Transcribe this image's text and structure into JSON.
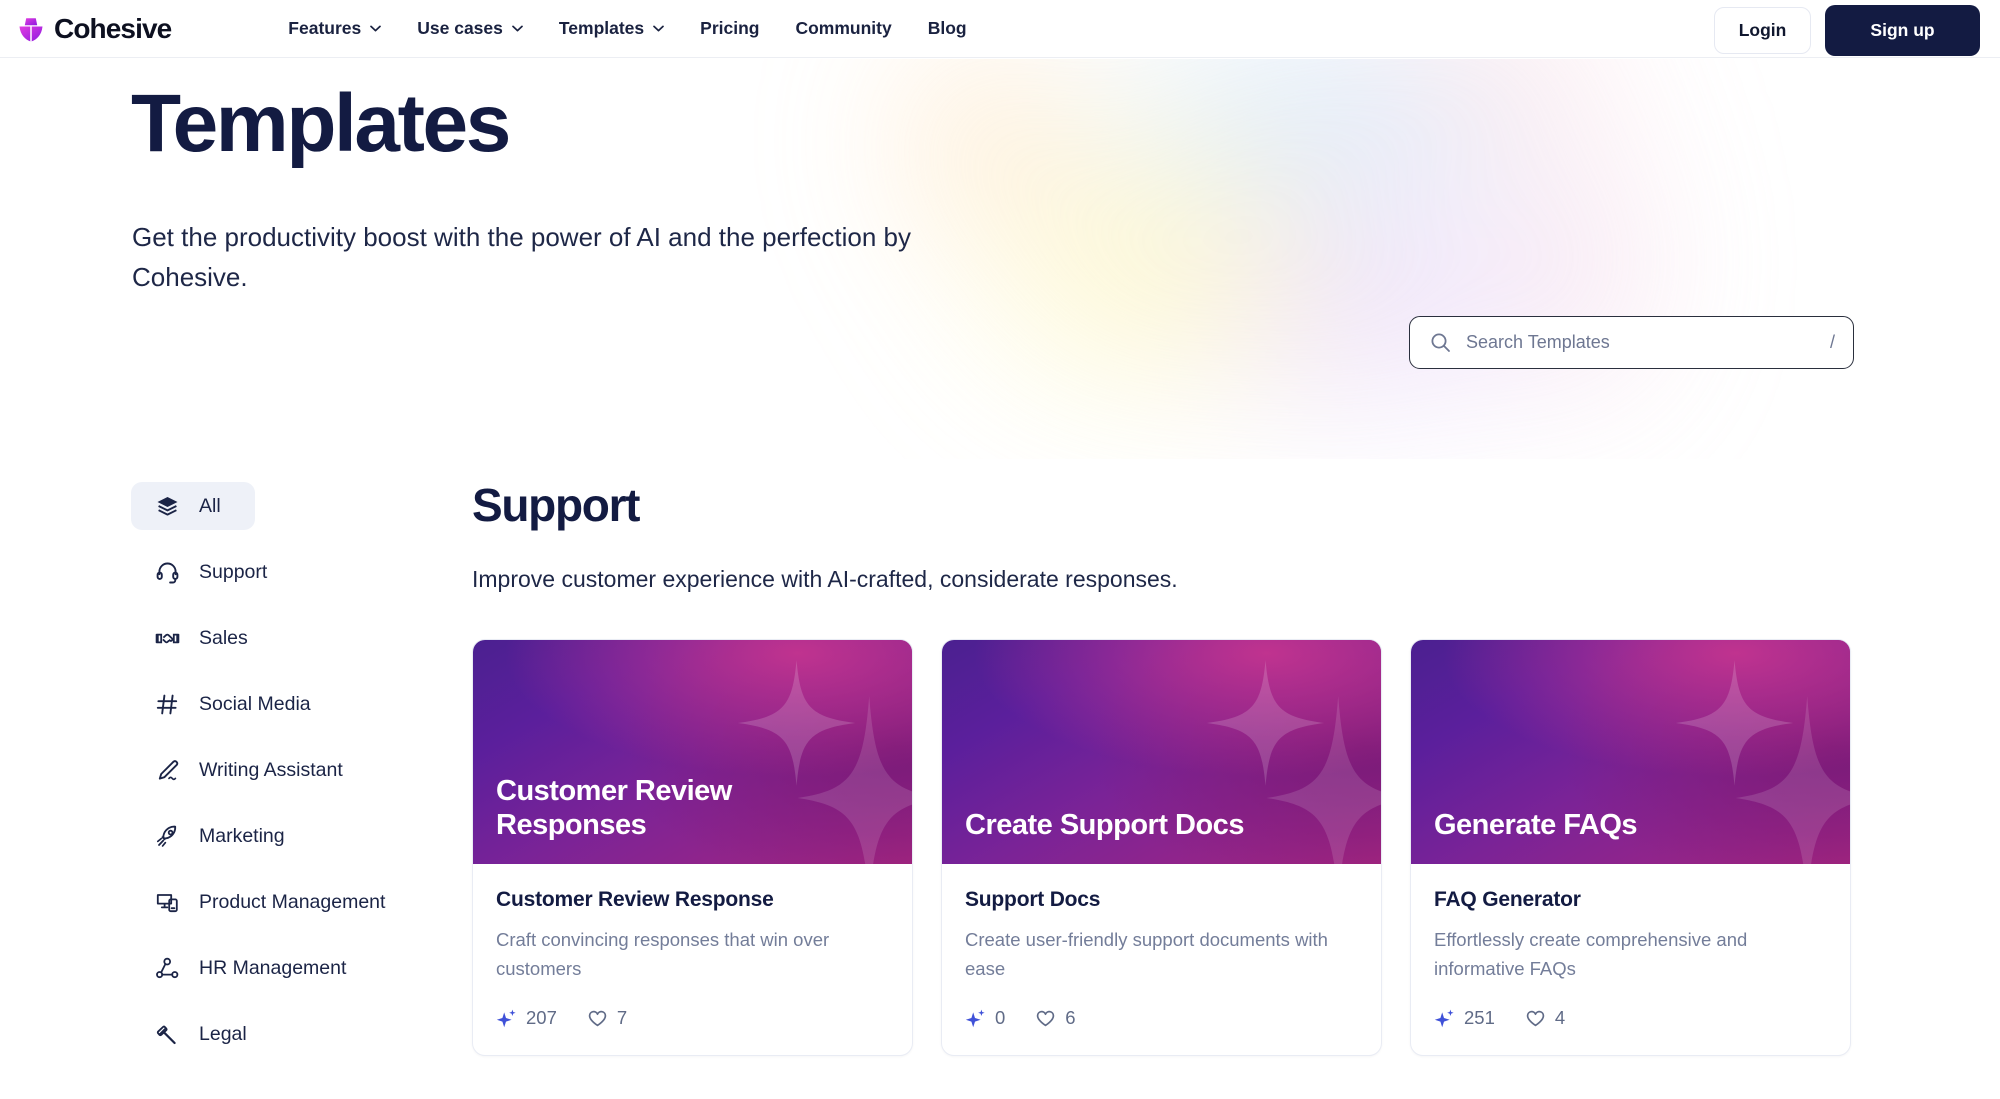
{
  "brand": {
    "name": "Cohesive",
    "logo_icon": "cohesive-ship-logo"
  },
  "nav": {
    "items": [
      {
        "label": "Features",
        "has_dropdown": true
      },
      {
        "label": "Use cases",
        "has_dropdown": true
      },
      {
        "label": "Templates",
        "has_dropdown": true
      },
      {
        "label": "Pricing",
        "has_dropdown": false
      },
      {
        "label": "Community",
        "has_dropdown": false
      },
      {
        "label": "Blog",
        "has_dropdown": false
      }
    ],
    "login_label": "Login",
    "signup_label": "Sign up"
  },
  "hero": {
    "title": "Templates",
    "subtitle": "Get the productivity boost with the power of AI and the perfection by Cohesive."
  },
  "search": {
    "placeholder": "Search Templates",
    "value": "",
    "shortcut": "/",
    "icon": "search-icon"
  },
  "sidebar": {
    "items": [
      {
        "label": "All",
        "icon": "layers-icon",
        "active": true
      },
      {
        "label": "Support",
        "icon": "headset-icon",
        "active": false
      },
      {
        "label": "Sales",
        "icon": "handshake-icon",
        "active": false
      },
      {
        "label": "Social Media",
        "icon": "hashtag-icon",
        "active": false
      },
      {
        "label": "Writing Assistant",
        "icon": "pen-icon",
        "active": false
      },
      {
        "label": "Marketing",
        "icon": "rocket-icon",
        "active": false
      },
      {
        "label": "Product Management",
        "icon": "devices-icon",
        "active": false
      },
      {
        "label": "HR Management",
        "icon": "network-users-icon",
        "active": false
      },
      {
        "label": "Legal",
        "icon": "gavel-icon",
        "active": false
      }
    ]
  },
  "main": {
    "section_title": "Support",
    "section_subtitle": "Improve customer experience with AI-crafted, considerate responses.",
    "cards": [
      {
        "thumb_title": "Customer Review Responses",
        "title": "Customer Review Response",
        "description": "Craft convincing responses that win over customers",
        "uses": "207",
        "likes": "7"
      },
      {
        "thumb_title": "Create Support Docs",
        "title": "Support Docs",
        "description": "Create user-friendly support documents with ease",
        "uses": "0",
        "likes": "6"
      },
      {
        "thumb_title": "Generate FAQs",
        "title": "FAQ Generator",
        "description": "Effortlessly create comprehensive and informative FAQs",
        "uses": "251",
        "likes": "4"
      }
    ]
  },
  "colors": {
    "navy": "#131b42",
    "accent_blue": "#3f51d8",
    "brand_purple": "#a02ce0",
    "brand_magenta": "#d832b8",
    "active_bg": "#eef1f8",
    "muted_text": "#737d99"
  }
}
